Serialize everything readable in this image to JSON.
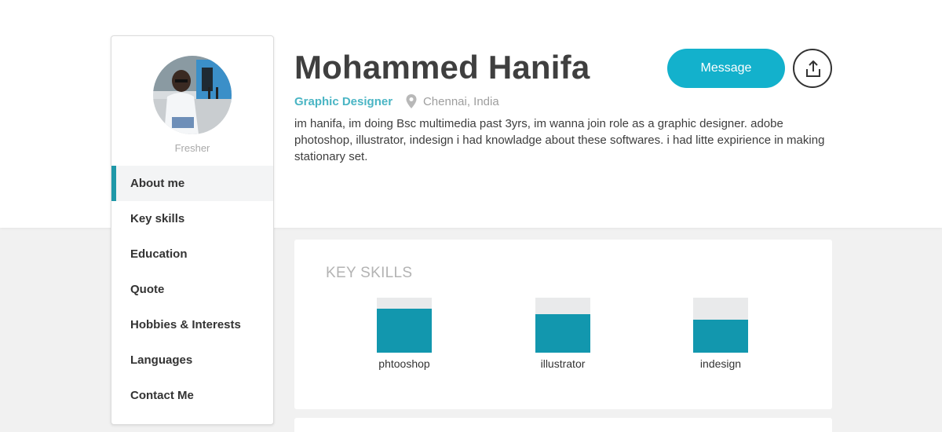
{
  "profile": {
    "name": "Mohammed Hanifa",
    "role": "Graphic Designer",
    "location": "Chennai, India",
    "status": "Fresher",
    "bio": "im hanifa, im doing Bsc multimedia past 3yrs, im wanna join role as a graphic designer. adobe photoshop, illustrator, indesign i had knowladge about these softwares. i had litte expirience in making stationary set."
  },
  "actions": {
    "message_label": "Message",
    "share_icon": "share-upload-icon"
  },
  "nav": {
    "items": [
      {
        "label": "About me",
        "active": true
      },
      {
        "label": "Key skills",
        "active": false
      },
      {
        "label": "Education",
        "active": false
      },
      {
        "label": "Quote",
        "active": false
      },
      {
        "label": "Hobbies & Interests",
        "active": false
      },
      {
        "label": "Languages",
        "active": false
      },
      {
        "label": "Contact Me",
        "active": false
      }
    ]
  },
  "skills": {
    "title": "KEY SKILLS",
    "items": [
      {
        "name": "phtooshop",
        "level": 0.8
      },
      {
        "name": "illustrator",
        "level": 0.7
      },
      {
        "name": "indesign",
        "level": 0.6
      }
    ]
  },
  "colors": {
    "accent": "#13b1cc",
    "bar": "#1297ae",
    "role": "#4ab5c4"
  }
}
